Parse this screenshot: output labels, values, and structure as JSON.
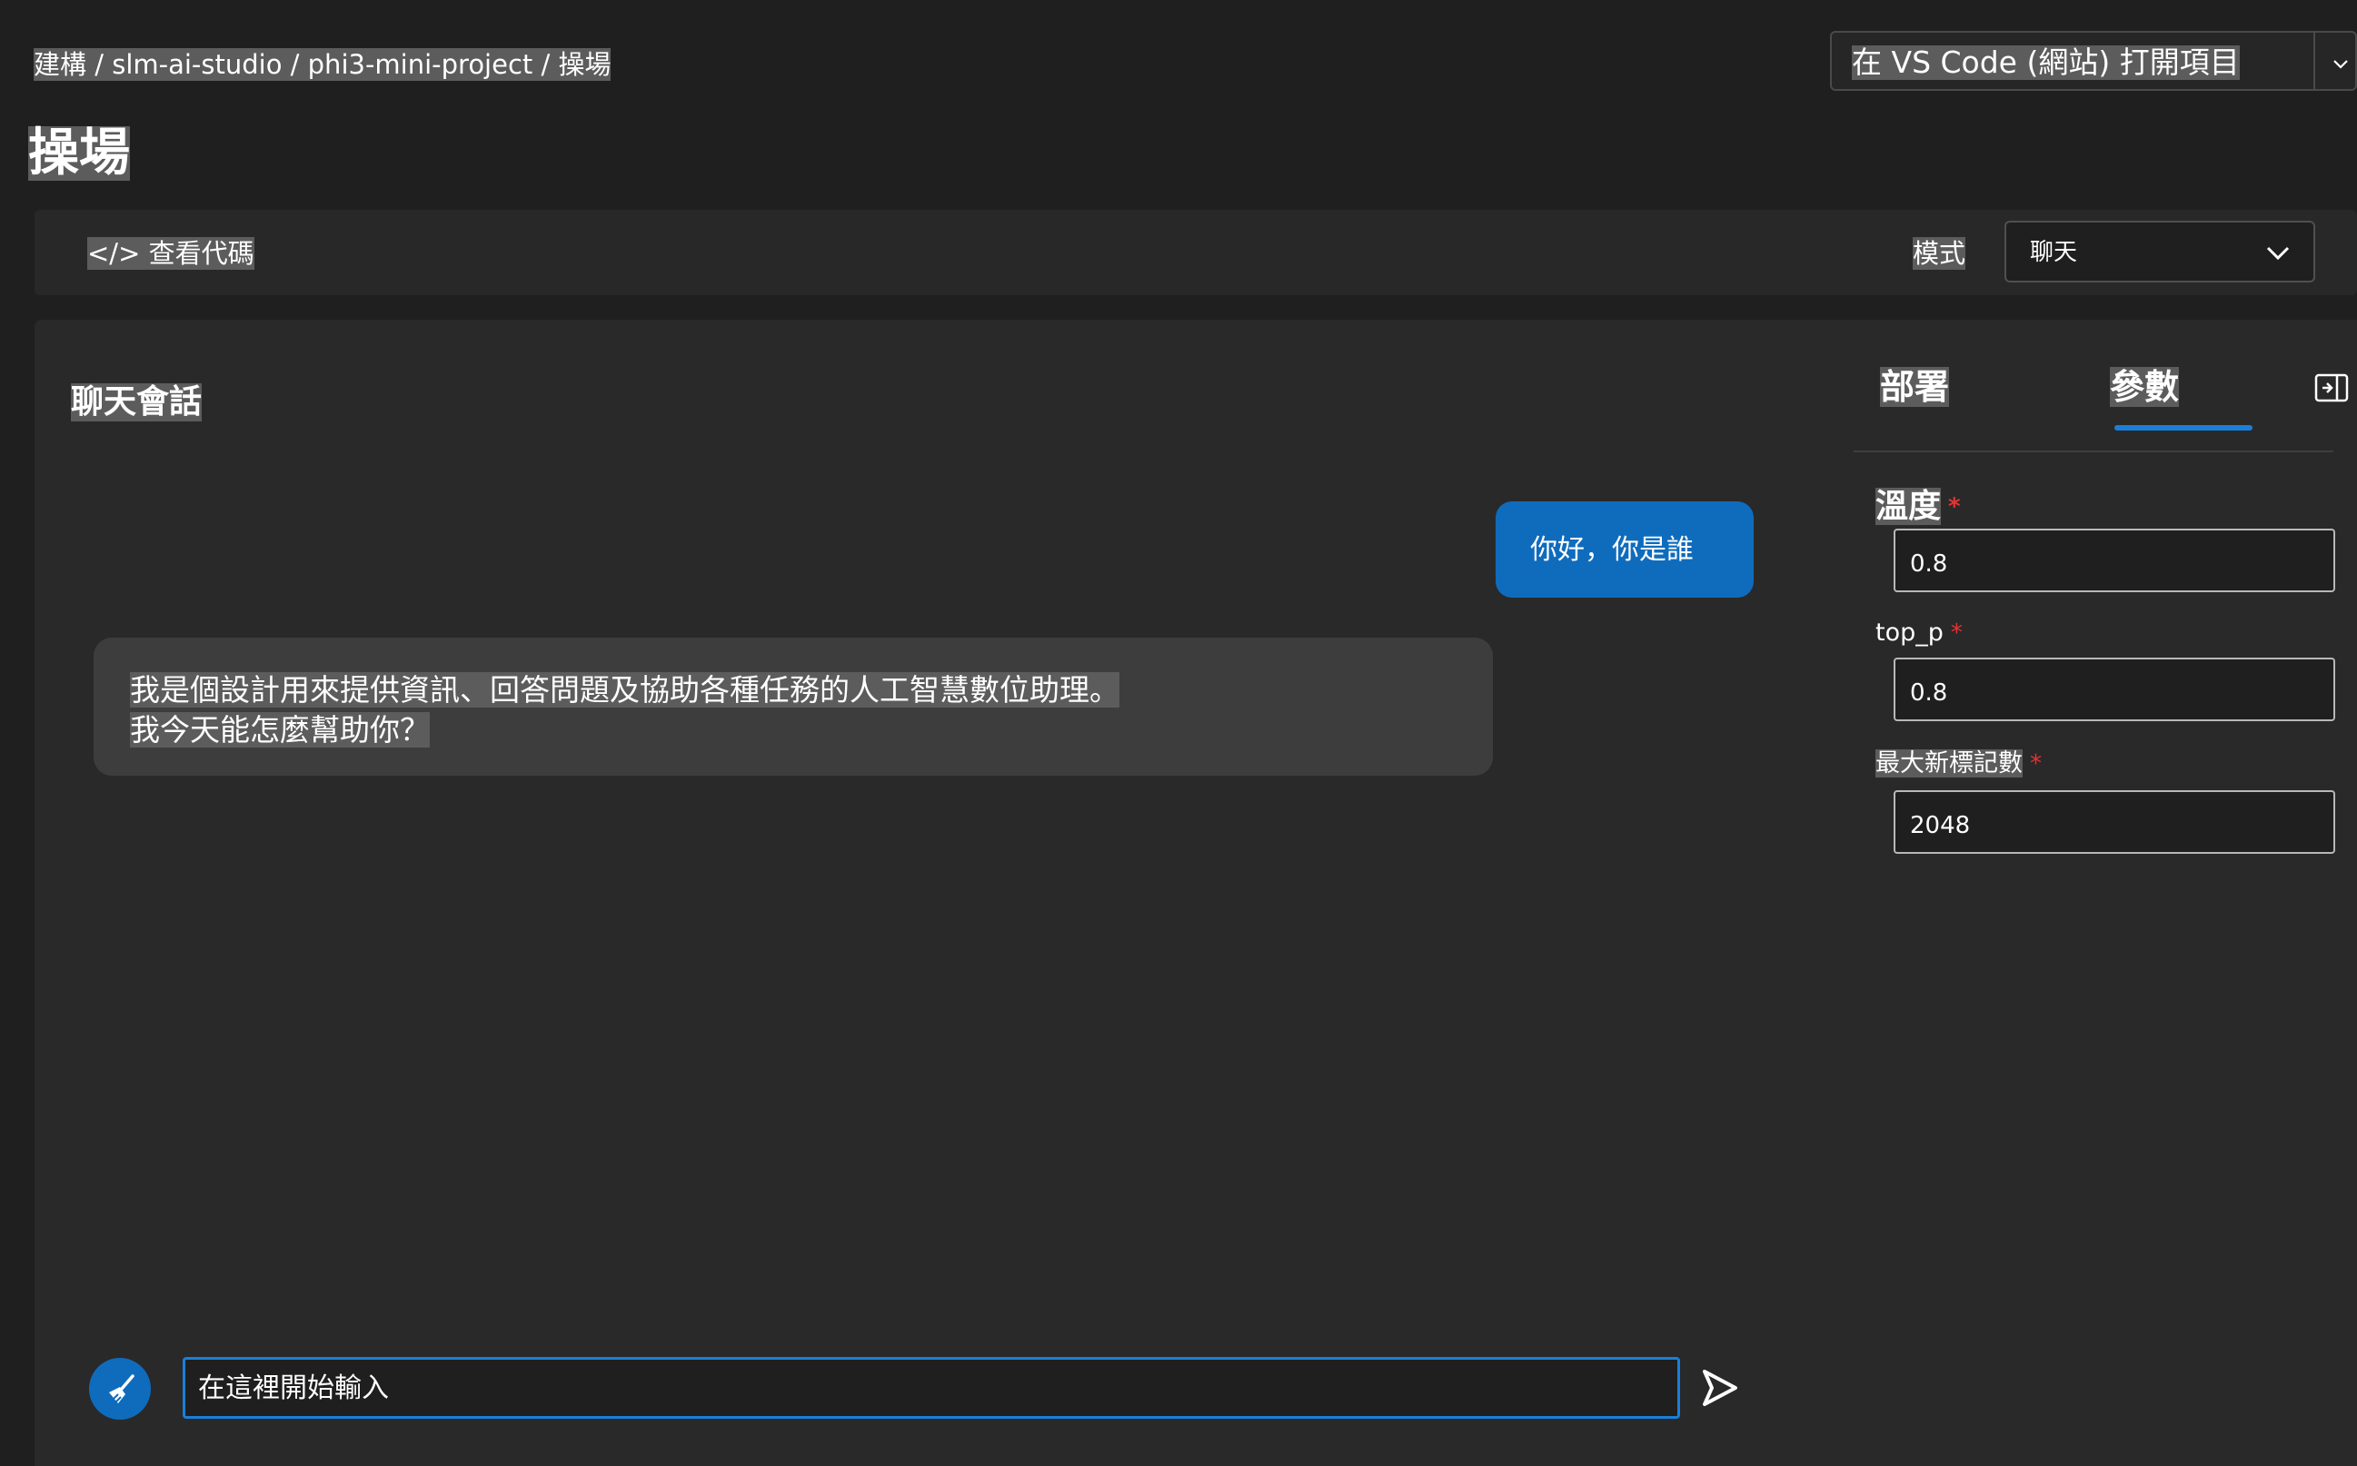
{
  "breadcrumb": "建構 / slm-ai-studio / phi3-mini-project / 操場",
  "open_button": {
    "label": "在 VS Code (網站) 打開項目"
  },
  "page_title": "操場",
  "toolbar": {
    "view_code": "</> 查看代碼",
    "mode_label": "模式",
    "mode_value": "聊天"
  },
  "chat": {
    "title": "聊天會話",
    "messages": [
      {
        "role": "user",
        "text": "你好，你是誰"
      },
      {
        "role": "assistant",
        "text": "我是個設計用來提供資訊、回答問題及協助各種任務的人工智慧數位助理。",
        "text2": "我今天能怎麼幫助你？"
      }
    ],
    "input_placeholder": "在這裡開始輸入"
  },
  "side_panel": {
    "tabs": [
      "部署",
      "參數"
    ],
    "active_tab": "參數",
    "fields": [
      {
        "label": "溫度",
        "required_mark": "*",
        "value": "0.8"
      },
      {
        "label": "top_p",
        "required_mark": "*",
        "value": "0.8"
      },
      {
        "label": "最大新標記數",
        "required_mark": "*",
        "value": "2048"
      }
    ]
  },
  "colors": {
    "accent": "#0f6cbd",
    "background": "#1f1f1f",
    "panel": "#292929",
    "required": "#e83232"
  },
  "icons": [
    "chevron-down-icon",
    "code-icon",
    "broom-icon",
    "send-icon",
    "panel-collapse-icon"
  ]
}
